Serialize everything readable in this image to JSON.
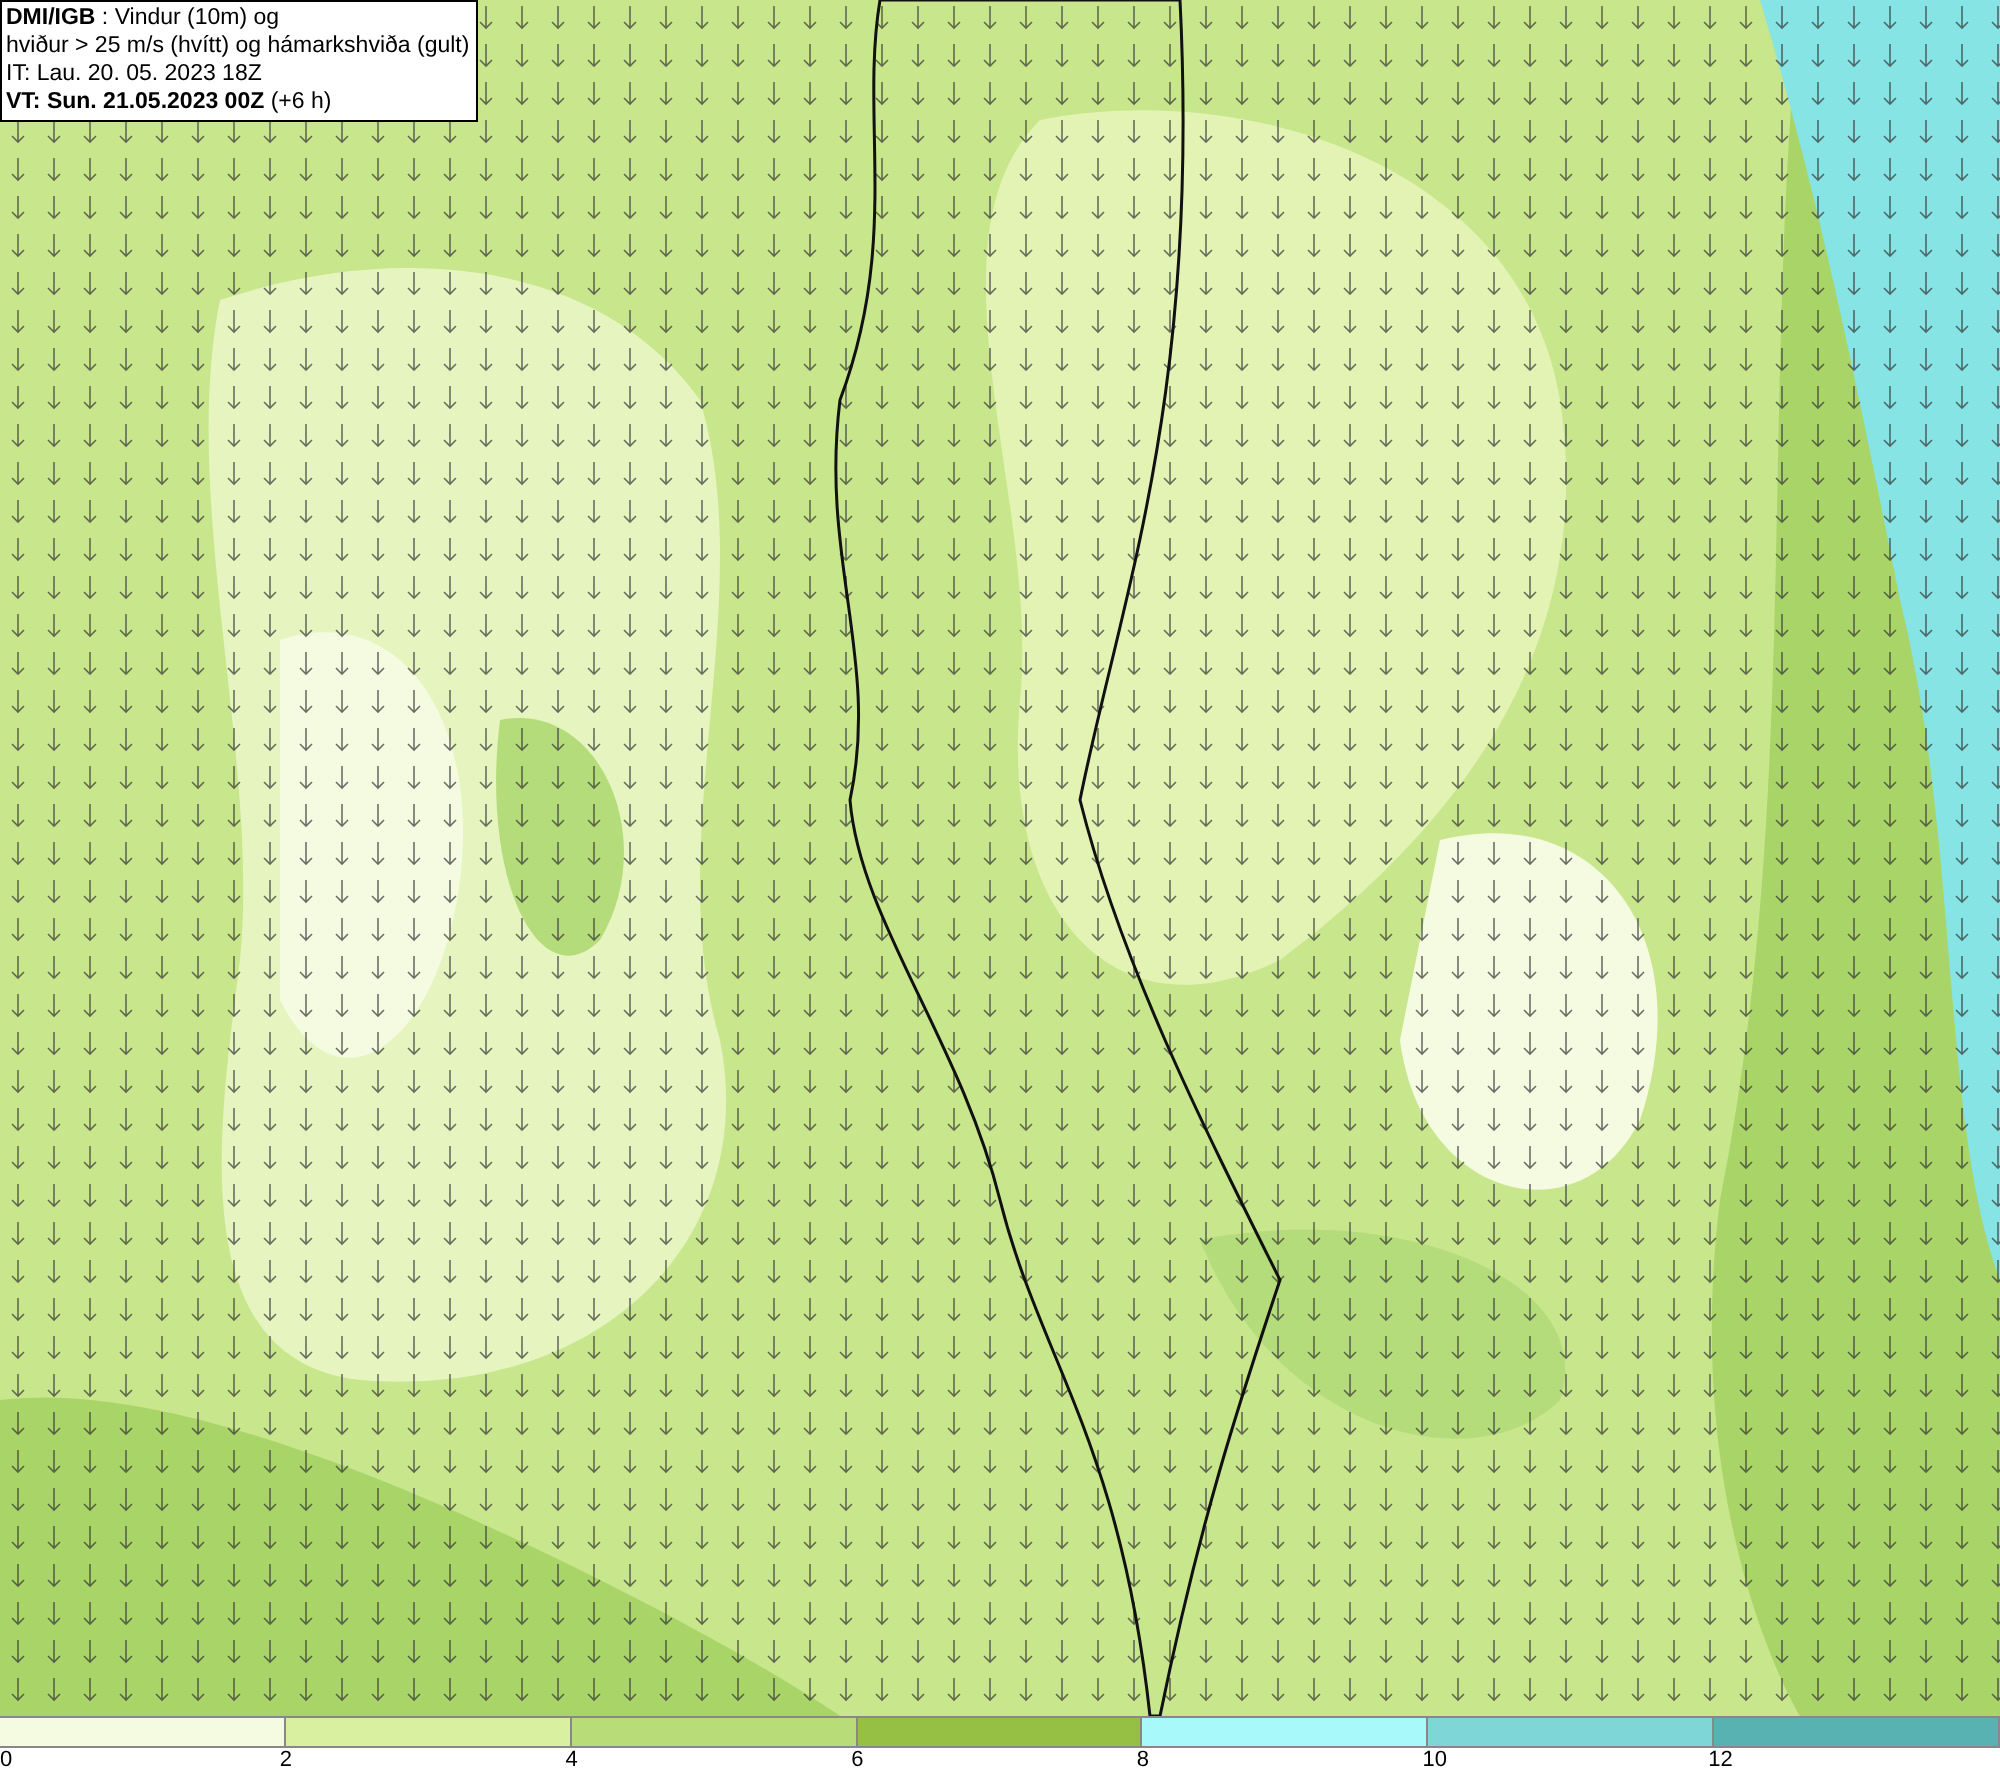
{
  "title_box": {
    "lines": [
      "**DMI/IGB** : Vindur (10m) og",
      "hviður > 25 m/s (hvítt) og hámarkshviða (gult)",
      "IT: Lau. 20. 05. 2023 18Z",
      "**VT: Sun. 21.05.2023 00Z** (+6 h)"
    ]
  },
  "legend": {
    "bands": [
      {
        "label": "0",
        "color": "#f5fbe0"
      },
      {
        "label": "2",
        "color": "#d8f0a0"
      },
      {
        "label": "4",
        "color": "#b8dc78"
      },
      {
        "label": "6",
        "color": "#96c044"
      },
      {
        "label": "8",
        "color": "#a8fafa"
      },
      {
        "label": "10",
        "color": "#7ed6d6"
      },
      {
        "label": "12",
        "color": "#58b2b2"
      }
    ]
  }
}
